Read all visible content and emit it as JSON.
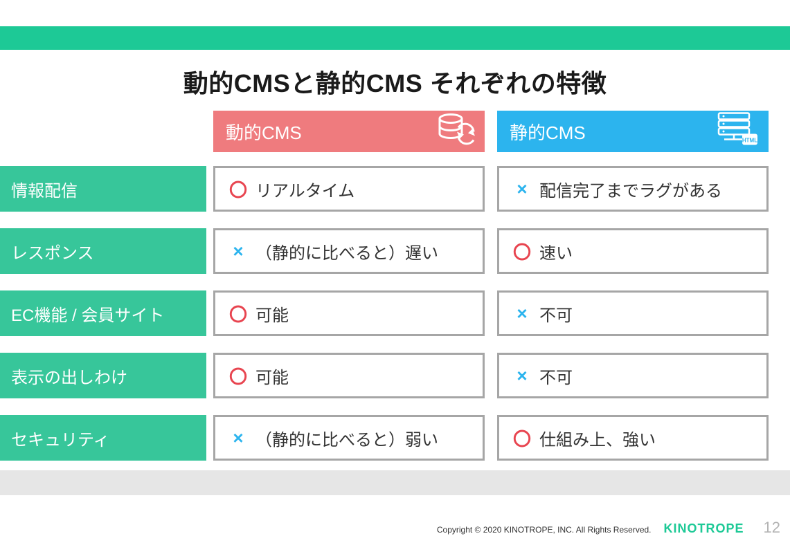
{
  "title": "動的CMSと静的CMS それぞれの特徴",
  "columns": {
    "dynamic": "動的CMS",
    "static": "静的CMS"
  },
  "rows": [
    {
      "label": "情報配信",
      "dynamic": {
        "mark": "〇",
        "text": "リアルタイム"
      },
      "static": {
        "mark": "×",
        "text": "配信完了までラグがある"
      }
    },
    {
      "label": "レスポンス",
      "dynamic": {
        "mark": "×",
        "text": "（静的に比べると）遅い"
      },
      "static": {
        "mark": "〇",
        "text": "速い"
      }
    },
    {
      "label": "EC機能 / 会員サイト",
      "dynamic": {
        "mark": "〇",
        "text": "可能"
      },
      "static": {
        "mark": "×",
        "text": "不可"
      }
    },
    {
      "label": "表示の出しわけ",
      "dynamic": {
        "mark": "〇",
        "text": "可能"
      },
      "static": {
        "mark": "×",
        "text": "不可"
      }
    },
    {
      "label": "セキュリティ",
      "dynamic": {
        "mark": "×",
        "text": "（静的に比べると）弱い"
      },
      "static": {
        "mark": "〇",
        "text": "仕組み上、強い"
      }
    }
  ],
  "footer": {
    "copyright": "Copyright © 2020 KINOTROPE, INC. All Rights Reserved.",
    "brand": "KINOTROPE",
    "page": "12"
  }
}
